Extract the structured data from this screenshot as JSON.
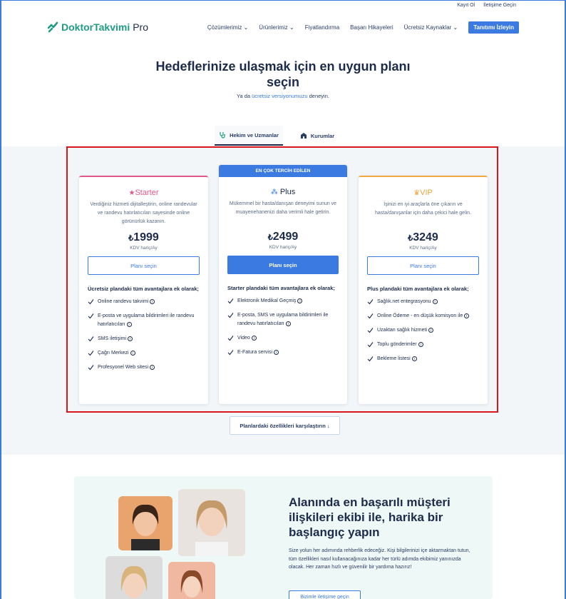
{
  "topbar": {
    "register": "Kayıt Ol",
    "contact": "İletişime Geçin"
  },
  "nav": {
    "brand_main": "DoktorTakvimi",
    "brand_pro": "Pro",
    "menu": [
      "Çözümlerimiz",
      "Ürünlerimiz",
      "Fiyatlandırma",
      "Başarı Hikayeleri",
      "Ücretsiz Kaynaklar"
    ],
    "cta": "Tanıtımı İzleyin"
  },
  "hero": {
    "title_line1": "Hedeflerinize ulaşmak için en uygun planı",
    "title_line2": "seçin",
    "sub_prefix": "Ya da ",
    "sub_link": "ücretsiz versiyonumuzu",
    "sub_suffix": " deneyin."
  },
  "tabs": [
    {
      "label": "Hekim ve Uzmanlar",
      "active": true
    },
    {
      "label": "Kurumlar",
      "active": false
    }
  ],
  "plans": [
    {
      "name": "Starter",
      "icon": "star-icon",
      "description": "Verdiğiniz hizmeti dijitalleştirin, online randevular ve randevu hatırlatıcıları sayesinde online görünürlük kazanın.",
      "currency": "₺",
      "price": "1999",
      "price_note": "KDV hariç/Ay",
      "button": "Planı seçin",
      "features_head": "Ücretsiz plandaki tüm avantajlara ek olarak;",
      "features": [
        "Online randevu takvimi",
        "E-posta ve uygulama bildirimleri ile randevu hatırlatıcıları",
        "SMS iletişimi",
        "Çağrı Merkezi",
        "Profesyonel Web sitesi"
      ]
    },
    {
      "ribbon": "EN ÇOK TERCİH EDİLEN",
      "name": "Plus",
      "icon": "cluster-icon",
      "description": "Mükemmel bir hasta/danışan deneyimi sunun ve muayenehanenizi daha verimli hale getirin.",
      "currency": "₺",
      "price": "2499",
      "price_note": "KDV hariç/Ay",
      "button": "Planı seçin",
      "features_head": "Starter plandaki tüm avantajlara ek olarak;",
      "features": [
        "Elektronik Medikal Geçmiş",
        "E-posta, SMS ve uygulama bildirimleri ile randevu hatırlatıcıları",
        "Video",
        "E-Fatura servisi"
      ]
    },
    {
      "name": "VIP",
      "icon": "crown-icon",
      "description": "İşinizi en iyi araçlarla öne çıkarın ve hasta/danışanlar için daha çekici hale gelin.",
      "currency": "₺",
      "price": "3249",
      "price_note": "KDV hariç/Ay",
      "button": "Planı seçin",
      "features_head": "Plus plandaki tüm avantajlara ek olarak;",
      "features": [
        "Sağlık.net entegrasyonu",
        "Online Ödeme - en düşük komisyon ile",
        "Uzaktan sağlık hizmeti",
        "Toplu gönderimler",
        "Bekleme listesi"
      ]
    }
  ],
  "compare_button": "Planlardaki özellikleri karşılaştırın ↓",
  "team": {
    "title": "Alanında en başarılı müşteri ilişkileri ekibi ile, harika bir başlangıç yapın",
    "text": "Size yolun her adımında rehberlik edeceğiz. Kişi bilgilerinizi içe aktarmaktan tutun, tüm özellikleri nasıl kullanacağınıza kadar her türlü adımda ekibimiz yanınızda olacak. Her zaman hızlı ve güvenilir bir yardıma hazırız!",
    "button": "Bizimle iletişime geçin"
  },
  "colors": {
    "brand": "#1f9d83",
    "accent": "#3b7ae0",
    "starter": "#e0578a",
    "vip": "#e8a33a",
    "highlight": "#d9161c"
  }
}
